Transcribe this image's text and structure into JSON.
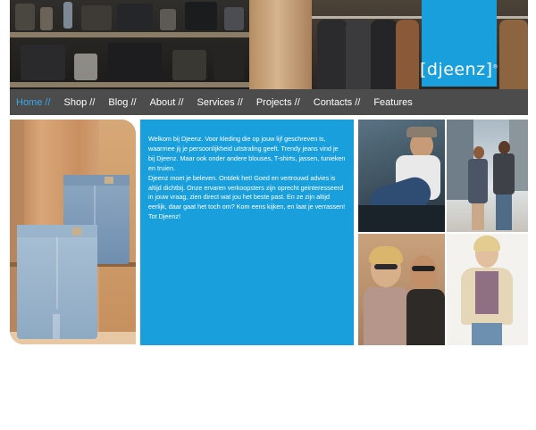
{
  "brand": {
    "logo_text": "[djeenz]",
    "logo_mark": "®",
    "accent_color": "#1a9fdd"
  },
  "nav": {
    "items": [
      {
        "label": "Home //",
        "active": true
      },
      {
        "label": "Shop //",
        "active": false
      },
      {
        "label": "Blog //",
        "active": false
      },
      {
        "label": "About //",
        "active": false
      },
      {
        "label": "Services //",
        "active": false
      },
      {
        "label": "Projects //",
        "active": false
      },
      {
        "label": "Contacts //",
        "active": false
      },
      {
        "label": "Features",
        "active": false
      }
    ],
    "background": "#4c4c4c",
    "active_color": "#39a8e8"
  },
  "main": {
    "intro_paragraph": "Welkom bij Djeenz. Voor kleding die op jouw lijf geschreven is, waarmee jij je persoonlijkheid uitstraling geeft. Trendy jeans vind je bij Djeenz. Maar ook onder andere blouses, T-shirts, jassen, tunieken en truien.",
    "second_paragraph": "Djeenz moet je beleven. Ontdek het! Goed en vertrouwd advies is altijd dichtbij. Onze ervaren verkoopsters zijn oprecht geinteresseerd in jouw vraag, zien direct wat jou het beste past. En ze zijn altijd eerlijk, daar gaat het toch om? Kom eens kijken, en laat je verrassen! Tot Djeenz!"
  }
}
